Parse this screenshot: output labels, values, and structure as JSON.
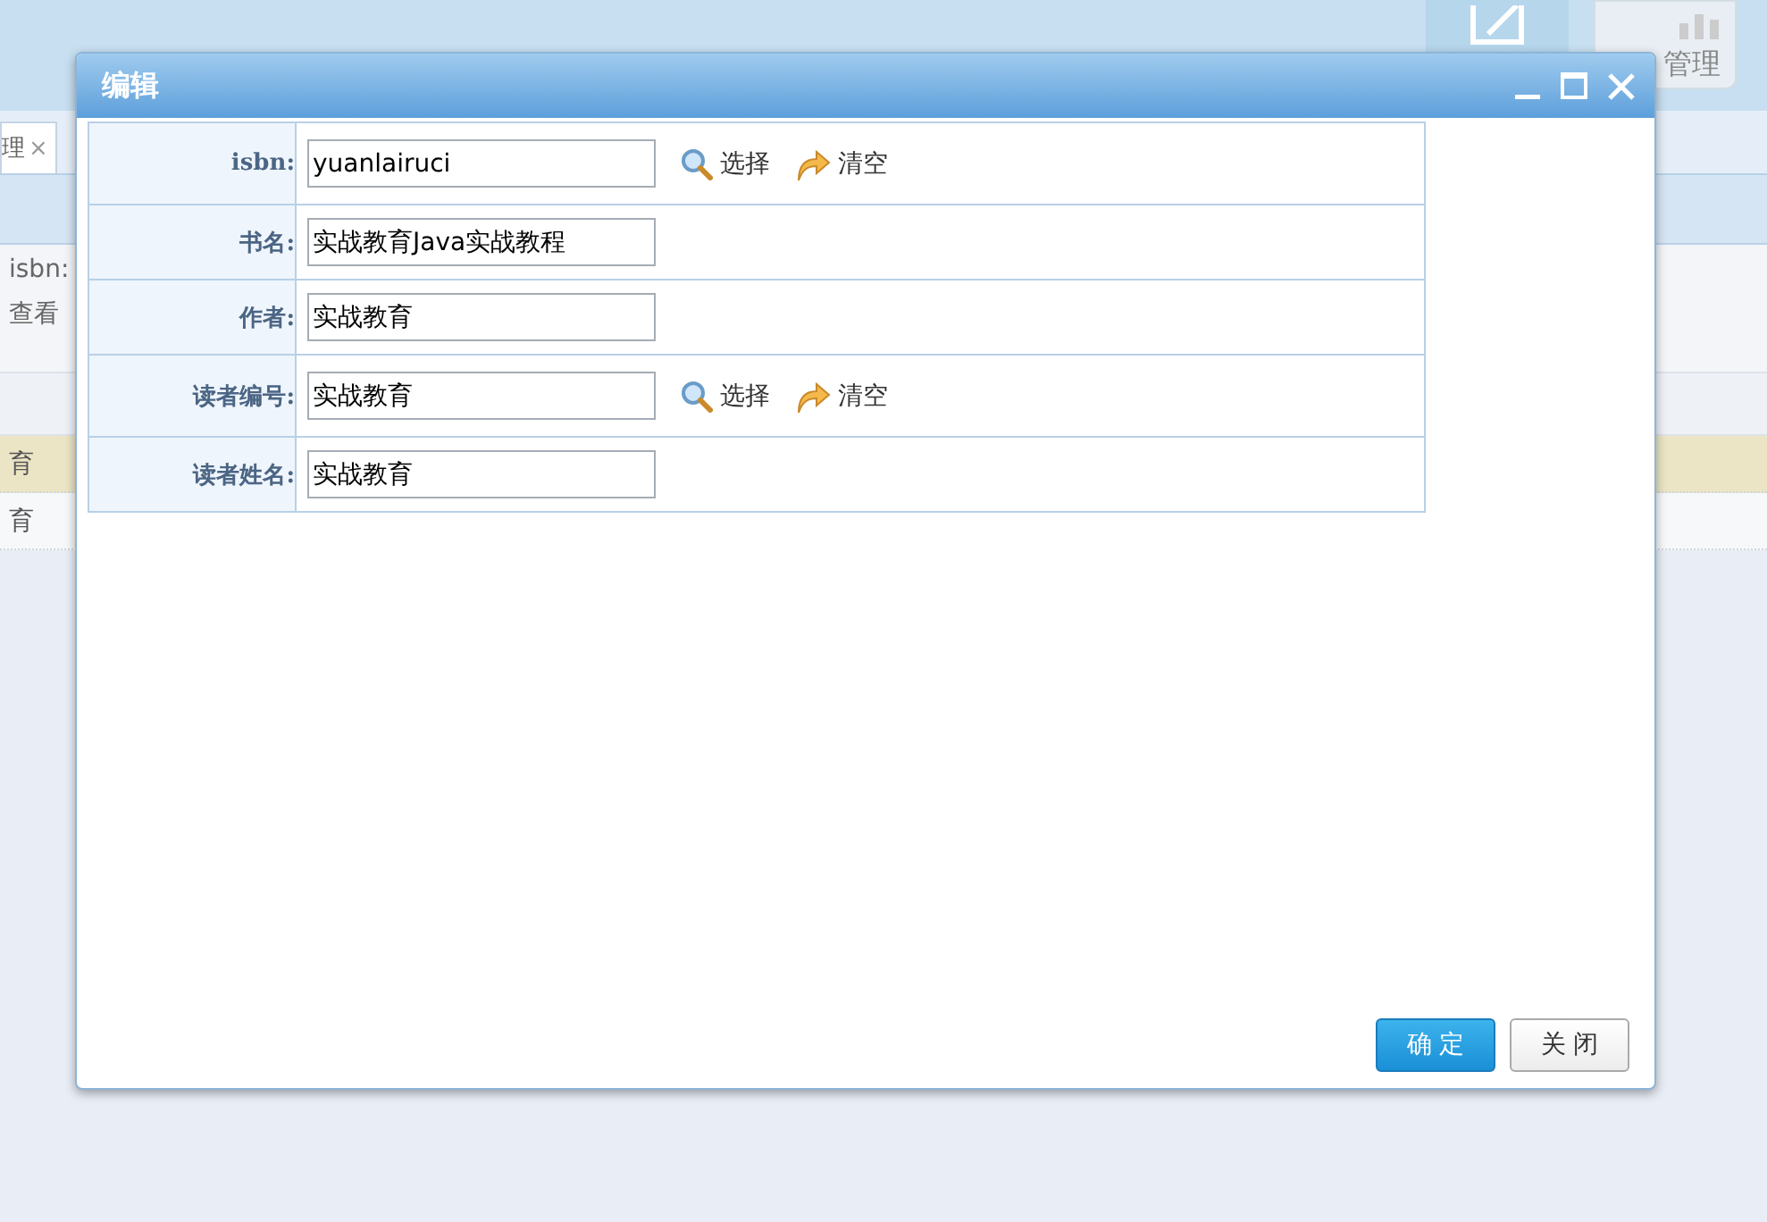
{
  "background": {
    "toolbar_buttons": [
      {
        "kind": "edit"
      },
      {
        "kind": "chart",
        "label": "管理"
      }
    ],
    "tab": {
      "label": "理",
      "close": "×"
    },
    "search": {
      "label": "isbn:",
      "button": "查看"
    },
    "rows": [
      {
        "cell": "育",
        "selected": true
      },
      {
        "cell": "育",
        "selected": false
      }
    ]
  },
  "dialog": {
    "title": "编辑",
    "fields": [
      {
        "label": "isbn:",
        "value": "yuanlairuci",
        "actions": [
          "选择",
          "清空"
        ]
      },
      {
        "label": "书名:",
        "value": "实战教育Java实战教程"
      },
      {
        "label": "作者:",
        "value": "实战教育"
      },
      {
        "label": "读者编号:",
        "value": "实战教育",
        "actions": [
          "选择",
          "清空"
        ]
      },
      {
        "label": "读者姓名:",
        "value": "实战教育"
      }
    ],
    "buttons": [
      {
        "label": "确 定",
        "kind": "primary"
      },
      {
        "label": "关 闭",
        "kind": "normal"
      }
    ]
  }
}
